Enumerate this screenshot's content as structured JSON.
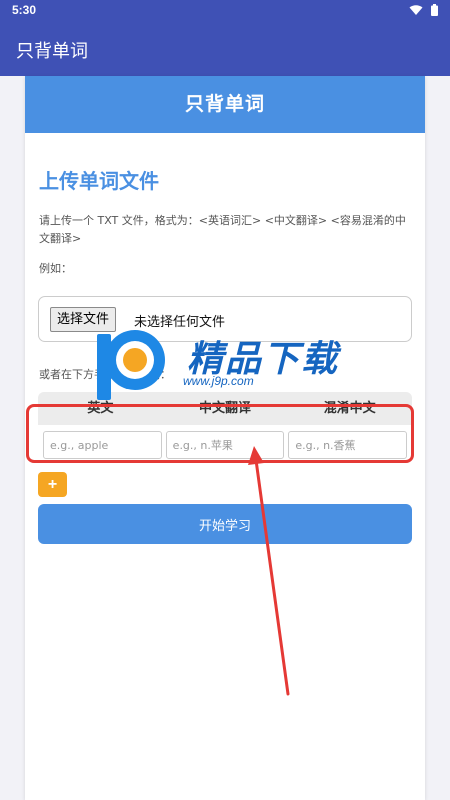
{
  "status_bar": {
    "time": "5:30",
    "icons": [
      "wifi-icon",
      "battery-icon"
    ]
  },
  "app_bar": {
    "title": "只背单词"
  },
  "card": {
    "header_title": "只背单词",
    "upload_title": "上传单词文件",
    "description": "请上传一个 TXT 文件，格式为：<英语词汇> <中文翻译> <容易混淆的中文翻译>",
    "example_label": "例如：",
    "file_button": "选择文件",
    "file_status": "未选择任何文件",
    "manual_label": "或者在下方手动输入单词：",
    "table": {
      "headers": [
        "英文",
        "中文翻译",
        "混淆中文"
      ],
      "row": {
        "en_placeholder": "e.g., apple",
        "cn_placeholder": "e.g., n.苹果",
        "confuse_placeholder": "e.g., n.香蕉"
      }
    },
    "add_button": "+",
    "start_button": "开始学习"
  },
  "watermark": {
    "text": "精品下载",
    "url": "www.j9p.com"
  },
  "colors": {
    "primary": "#3f51b5",
    "accent": "#4a90e2",
    "warning": "#f5a623",
    "annotation": "#e53935"
  }
}
